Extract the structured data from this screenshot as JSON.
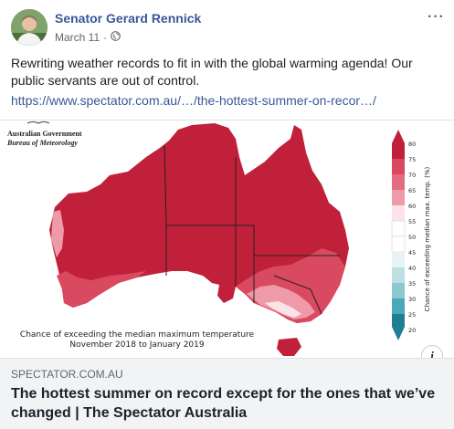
{
  "post": {
    "author": "Senator Gerard Rennick",
    "date": "March 11",
    "privacy_icon": "globe-icon",
    "more_icon": "more-options-icon",
    "text": "Rewriting weather records to fit in with the global warming agenda! Our public servants are out of control.",
    "link": "https://www.spectator.com.au/…/the-hottest-summer-on-recor…/"
  },
  "map": {
    "org_line1": "Australian Government",
    "org_line2": "Bureau of Meteorology",
    "caption_line1": "Chance of exceeding the median maximum temperature",
    "caption_line2": "November 2018 to January 2019",
    "legend_title": "Chance of exceeding median max. temp. (%)",
    "legend_ticks": [
      "80",
      "75",
      "70",
      "65",
      "60",
      "55",
      "50",
      "45",
      "40",
      "35",
      "30",
      "25",
      "20"
    ],
    "colors": {
      "dark_red": "#c0203a",
      "mid_red": "#d9495f",
      "light_red": "#ef9aa8",
      "pale": "#fbe3e7",
      "teal_light": "#bfe0e3",
      "teal": "#4aa8b8",
      "teal_dark": "#1f7e93"
    }
  },
  "card": {
    "domain": "SPECTATOR.COM.AU",
    "title": "The hottest summer on record except for the ones that we’ve changed | The Spectator Australia",
    "info_label": "i"
  }
}
